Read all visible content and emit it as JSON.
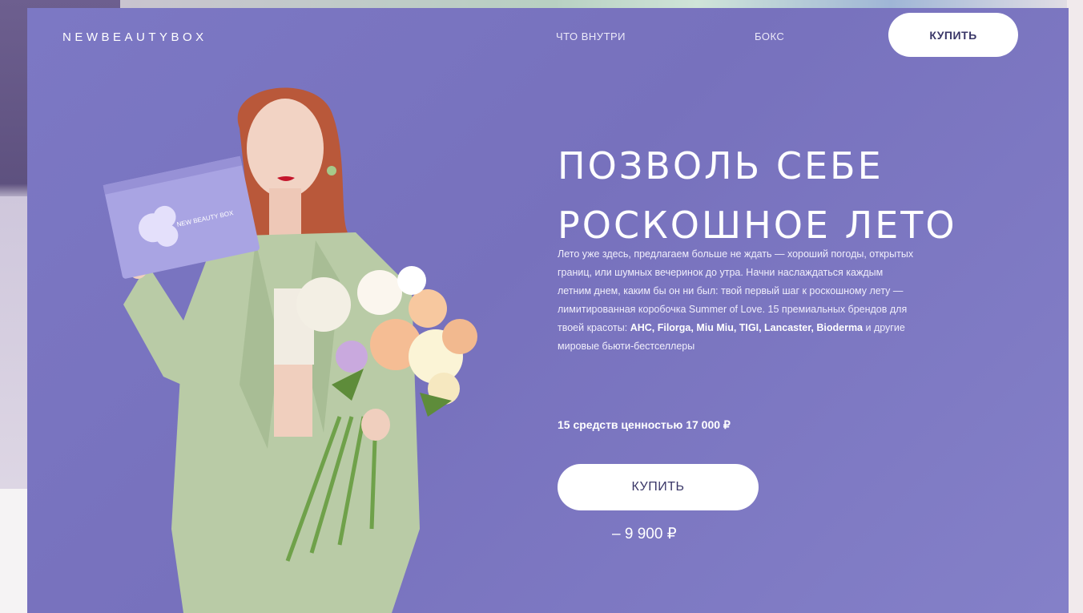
{
  "nav": {
    "logo": "NEWBEAUTYBOX",
    "links": [
      "ЧТО ВНУТРИ",
      "БОКС"
    ],
    "buy_label": "КУПИТЬ"
  },
  "hero": {
    "title_line1": "ПОЗВОЛЬ СЕБЕ",
    "title_line2": "РОСКОШНОЕ ЛЕТО",
    "body_intro": "Лето уже здесь, предлагаем больше не ждать — хороший погоды, открытых границ, или шумных вечеринок до утра. Начни наслаждаться каждым летним днем, каким бы он ни был: твой первый шаг к роскошному лету — лимитированная коробочка Summer of Love. 15 премиальных брендов для твоей красоты: ",
    "brands": "AHC, Filorga, Miu Miu, TIGI, Lancaster, Bioderma",
    "body_outro": " и другие мировые бьюти-бестселлеры",
    "value_text": "15 средств ценностью 17 000 ₽",
    "cta_label": "КУПИТЬ",
    "price": "– 9 900 ₽"
  },
  "product": {
    "box_text": "NEW BEAUTY BOX"
  },
  "colors": {
    "card_bg": "#7c78c4",
    "button_bg": "#ffffff",
    "button_text": "#3a3768",
    "jacket": "#b9cba6"
  }
}
